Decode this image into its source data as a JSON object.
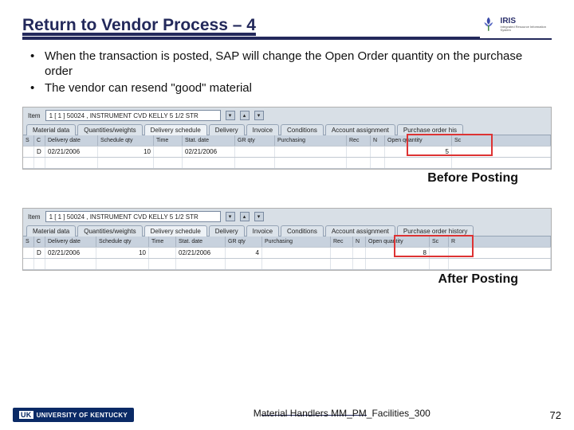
{
  "header": {
    "title": "Return to Vendor Process – 4",
    "logo_text": "IRIS",
    "logo_sub": "Integrated Resource Information System"
  },
  "bullets": [
    "When the transaction is posted, SAP will change the Open Order quantity on the purchase order",
    "The vendor can resend \"good\" material"
  ],
  "sap_before": {
    "item_label": "Item",
    "item_value": "1 [ 1 ] 50024 , INSTRUMENT CVD KELLY 5 1/2 STR",
    "tabs": [
      "Material data",
      "Quantities/weights",
      "Delivery schedule",
      "Delivery",
      "Invoice",
      "Conditions",
      "Account assignment",
      "Purchase order his"
    ],
    "columns": [
      "S",
      "C",
      "Delivery date",
      "Schedule qty",
      "Time",
      "Stat. date",
      "GR qty",
      "Purchasing",
      "Rec",
      "N",
      "Open quantity",
      "Sc"
    ],
    "row": {
      "s": "",
      "c": "D",
      "delivery_date": "02/21/2006",
      "sched_qty": "10",
      "time": "",
      "stat_date": "02/21/2006",
      "gr_qty": "",
      "purch": "",
      "rec": "",
      "n": "",
      "open_qty": "5",
      "sc": ""
    }
  },
  "caption_before": "Before Posting",
  "sap_after": {
    "item_label": "Item",
    "item_value": "1 [ 1 ] 50024 , INSTRUMENT CVD KELLY 5 1/2 STR",
    "tabs": [
      "Material data",
      "Quantities/weights",
      "Delivery schedule",
      "Delivery",
      "Invoice",
      "Conditions",
      "Account assignment",
      "Purchase order history"
    ],
    "columns": [
      "S",
      "C",
      "Delivery date",
      "Schedule qty",
      "Time",
      "Stat. date",
      "GR qty",
      "Purchasing",
      "Rec",
      "N",
      "Open quantity",
      "Sc",
      "R"
    ],
    "row": {
      "s": "",
      "c": "D",
      "delivery_date": "02/21/2006",
      "sched_qty": "10",
      "time": "",
      "stat_date": "02/21/2006",
      "gr_qty": "4",
      "purch": "",
      "rec": "",
      "n": "",
      "open_qty": "8",
      "sc": "",
      "r": ""
    }
  },
  "caption_after": "After Posting",
  "footer": {
    "uk": "UK",
    "uk_text": "UNIVERSITY OF KENTUCKY",
    "center": "Material Handlers MM_PM_Facilities_300",
    "page": "72"
  }
}
